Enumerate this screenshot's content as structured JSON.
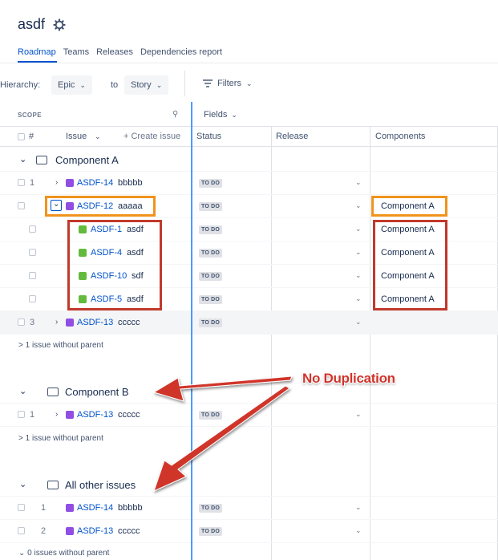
{
  "project": {
    "title": "asdf"
  },
  "tabs": [
    "Roadmap",
    "Teams",
    "Releases",
    "Dependencies report"
  ],
  "toolbar": {
    "hierarchy_label": "Hierarchy:",
    "from_value": "Epic",
    "to_label": "to",
    "to_value": "Story",
    "filters_label": "Filters"
  },
  "scope": {
    "label": "SCOPE",
    "fields_label": "Fields"
  },
  "columns": {
    "number": "#",
    "issue": "Issue",
    "create_issue": "+ Create issue",
    "status": "Status",
    "release": "Release",
    "components": "Components"
  },
  "groups": [
    {
      "title": "Component A",
      "rows": [
        {
          "num": "1",
          "key": "ASDF-14",
          "summary": "bbbbb",
          "status": "TO DO",
          "component": ""
        },
        {
          "num": "",
          "key": "ASDF-12",
          "summary": "aaaaa",
          "status": "TO DO",
          "component": "Component A"
        },
        {
          "num": "",
          "key": "ASDF-1",
          "summary": "asdf",
          "status": "TO DO",
          "component": "Component A"
        },
        {
          "num": "",
          "key": "ASDF-4",
          "summary": "asdf",
          "status": "TO DO",
          "component": "Component A"
        },
        {
          "num": "",
          "key": "ASDF-10",
          "summary": "sdf",
          "status": "TO DO",
          "component": "Component A"
        },
        {
          "num": "",
          "key": "ASDF-5",
          "summary": "asdf",
          "status": "TO DO",
          "component": "Component A"
        },
        {
          "num": "3",
          "key": "ASDF-13",
          "summary": "ccccc",
          "status": "TO DO",
          "component": ""
        }
      ],
      "no_parent": "> 1 issue without parent"
    },
    {
      "title": "Component B",
      "rows": [
        {
          "num": "1",
          "key": "ASDF-13",
          "summary": "ccccc",
          "status": "TO DO",
          "component": ""
        }
      ],
      "no_parent": "> 1 issue without parent"
    },
    {
      "title": "All other issues",
      "rows": [
        {
          "num": "1",
          "key": "ASDF-14",
          "summary": "bbbbb",
          "status": "TO DO",
          "component": ""
        },
        {
          "num": "2",
          "key": "ASDF-13",
          "summary": "ccccc",
          "status": "TO DO",
          "component": ""
        }
      ],
      "no_parent": "⌄ 0 issues without parent"
    }
  ],
  "annotation": {
    "text": "No Duplication"
  },
  "colors": {
    "link": "#0052cc",
    "epic": "#904ee2",
    "story": "#63ba3c",
    "divider_blue": "#4c9aff",
    "highlight_orange": "#f0931d",
    "highlight_red": "#c0392b"
  }
}
